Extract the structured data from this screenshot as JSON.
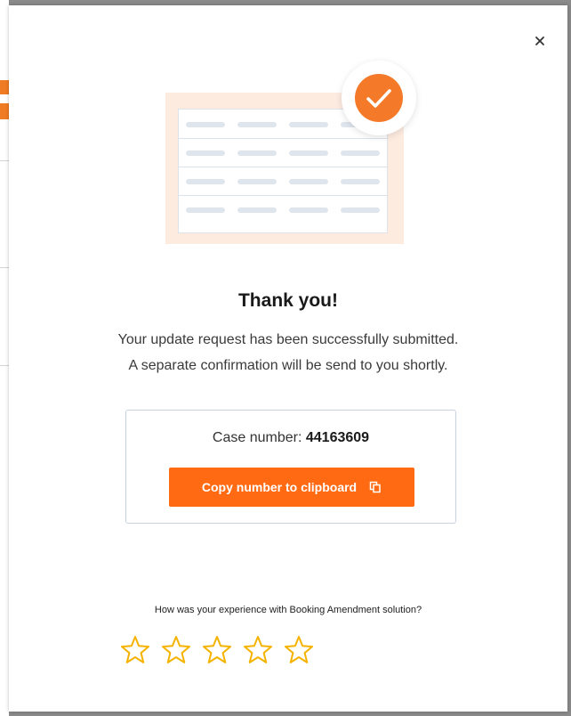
{
  "dialog": {
    "close_symbol": "×",
    "illustration_icon": "document-table-icon",
    "success_icon": "check-circle-icon",
    "title": "Thank you!",
    "message_line1": "Your update request has been successfully submitted.",
    "message_line2": "A separate confirmation will be send to you shortly.",
    "case_label": "Case number:",
    "case_number": "44163609",
    "copy_button_label": "Copy number to clipboard",
    "copy_icon": "copy-icon",
    "rating_question": "How was your experience with Booking Amendment solution?",
    "rating": {
      "max_stars": 5,
      "selected": 0
    }
  },
  "colors": {
    "accent": "#ff6a13",
    "success_badge": "#f47a2a",
    "star_outline": "#f5b301",
    "case_border": "#c7d3e0"
  }
}
